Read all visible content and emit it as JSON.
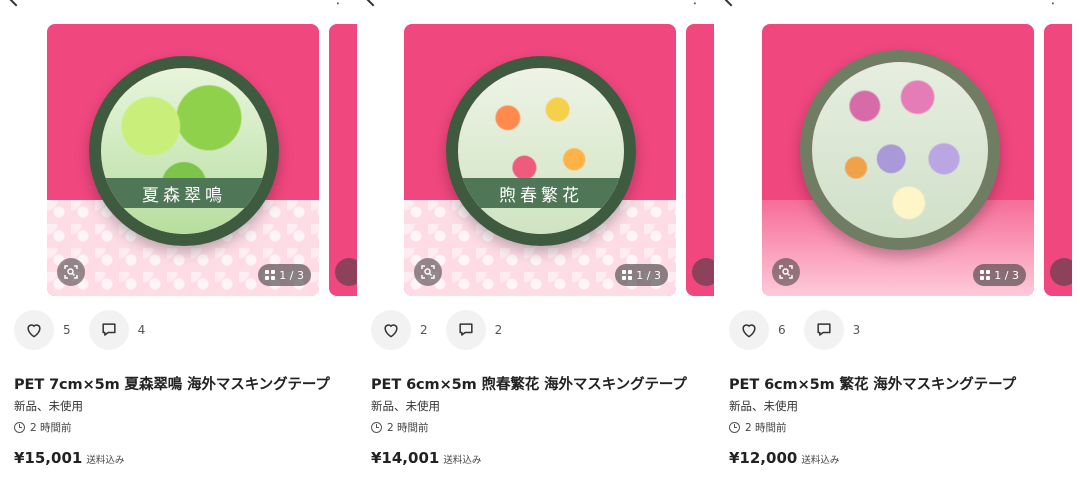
{
  "items": [
    {
      "tape_label": "夏森翠鳴",
      "page_indicator": "1 / 3",
      "likes": "5",
      "comments": "4",
      "title": "PET 7cm×5m 夏森翠鳴 海外マスキングテープ",
      "condition": "新品、未使用",
      "posted": "2 時間前",
      "price": "¥15,001",
      "shipping": "送料込み"
    },
    {
      "tape_label": "煦春繁花",
      "page_indicator": "1 / 3",
      "likes": "2",
      "comments": "2",
      "title": "PET 6cm×5m 煦春繁花 海外マスキングテープ",
      "condition": "新品、未使用",
      "posted": "2 時間前",
      "price": "¥14,001",
      "shipping": "送料込み"
    },
    {
      "tape_label": "",
      "page_indicator": "1 / 3",
      "likes": "6",
      "comments": "3",
      "title": "PET 6cm×5m 繁花 海外マスキングテープ",
      "condition": "新品、未使用",
      "posted": "2 時間前",
      "price": "¥12,000",
      "shipping": "送料込み"
    }
  ],
  "icons": {
    "back": "chevron-left-icon",
    "more": "more-vertical-icon",
    "lens": "image-search-icon",
    "grid": "grid-icon",
    "like": "heart-icon",
    "comment": "comment-icon",
    "clock": "clock-icon"
  },
  "colors": {
    "background_pink": "#f0477f",
    "tape_green": "#3e5b3f",
    "button_gray": "#f2f2f2"
  }
}
